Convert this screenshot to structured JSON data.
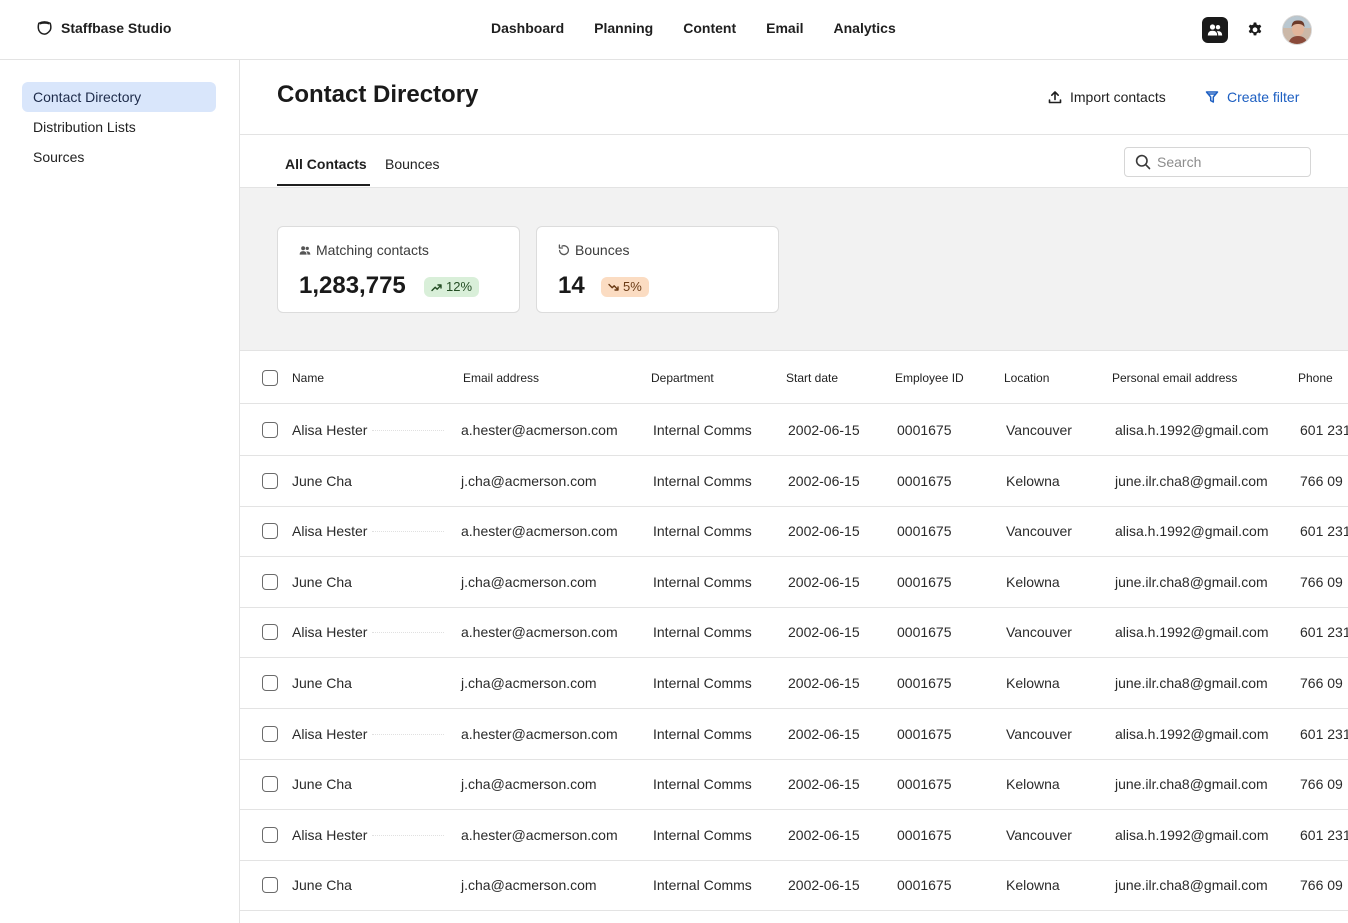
{
  "app": {
    "brand": "Staffbase Studio"
  },
  "nav": [
    "Dashboard",
    "Planning",
    "Content",
    "Email",
    "Analytics"
  ],
  "topbar": {
    "icons": [
      "people-icon",
      "gear-icon",
      "user-avatar"
    ]
  },
  "sidebar": {
    "items": [
      {
        "label": "Contact Directory",
        "active": true
      },
      {
        "label": "Distribution Lists",
        "active": false
      },
      {
        "label": "Sources",
        "active": false
      }
    ]
  },
  "page": {
    "title": "Contact Directory",
    "import_label": "Import contacts",
    "filter_label": "Create filter"
  },
  "tabs": [
    {
      "label": "All Contacts",
      "active": true
    },
    {
      "label": "Bounces",
      "active": false
    }
  ],
  "search": {
    "placeholder": "Search",
    "value": ""
  },
  "stats": {
    "matching": {
      "label": "Matching contacts",
      "value": "1,283,775",
      "change": "12%",
      "trend": "up"
    },
    "bounces": {
      "label": "Bounces",
      "value": "14",
      "change": "5%",
      "trend": "down"
    }
  },
  "table": {
    "columns": [
      "Name",
      "Email address",
      "Department",
      "Start date",
      "Employee ID",
      "Location",
      "Personal email address",
      "Phone"
    ],
    "rows": [
      {
        "name": "Alisa Hester",
        "email": "a.hester@acmerson.com",
        "department": "Internal Comms",
        "start": "2002-06-15",
        "id": "0001675",
        "location": "Vancouver",
        "personal": "alisa.h.1992@gmail.com",
        "phone": "601 231"
      },
      {
        "name": "June Cha",
        "email": "j.cha@acmerson.com",
        "department": "Internal Comms",
        "start": "2002-06-15",
        "id": "0001675",
        "location": "Kelowna",
        "personal": "june.ilr.cha8@gmail.com",
        "phone": "766 09"
      },
      {
        "name": "Alisa Hester",
        "email": "a.hester@acmerson.com",
        "department": "Internal Comms",
        "start": "2002-06-15",
        "id": "0001675",
        "location": "Vancouver",
        "personal": "alisa.h.1992@gmail.com",
        "phone": "601 231"
      },
      {
        "name": "June Cha",
        "email": "j.cha@acmerson.com",
        "department": "Internal Comms",
        "start": "2002-06-15",
        "id": "0001675",
        "location": "Kelowna",
        "personal": "june.ilr.cha8@gmail.com",
        "phone": "766 09"
      },
      {
        "name": "Alisa Hester",
        "email": "a.hester@acmerson.com",
        "department": "Internal Comms",
        "start": "2002-06-15",
        "id": "0001675",
        "location": "Vancouver",
        "personal": "alisa.h.1992@gmail.com",
        "phone": "601 231"
      },
      {
        "name": "June Cha",
        "email": "j.cha@acmerson.com",
        "department": "Internal Comms",
        "start": "2002-06-15",
        "id": "0001675",
        "location": "Kelowna",
        "personal": "june.ilr.cha8@gmail.com",
        "phone": "766 09"
      },
      {
        "name": "Alisa Hester",
        "email": "a.hester@acmerson.com",
        "department": "Internal Comms",
        "start": "2002-06-15",
        "id": "0001675",
        "location": "Vancouver",
        "personal": "alisa.h.1992@gmail.com",
        "phone": "601 231"
      },
      {
        "name": "June Cha",
        "email": "j.cha@acmerson.com",
        "department": "Internal Comms",
        "start": "2002-06-15",
        "id": "0001675",
        "location": "Kelowna",
        "personal": "june.ilr.cha8@gmail.com",
        "phone": "766 09"
      },
      {
        "name": "Alisa Hester",
        "email": "a.hester@acmerson.com",
        "department": "Internal Comms",
        "start": "2002-06-15",
        "id": "0001675",
        "location": "Vancouver",
        "personal": "alisa.h.1992@gmail.com",
        "phone": "601 231"
      },
      {
        "name": "June Cha",
        "email": "j.cha@acmerson.com",
        "department": "Internal Comms",
        "start": "2002-06-15",
        "id": "0001675",
        "location": "Kelowna",
        "personal": "june.ilr.cha8@gmail.com",
        "phone": "766 09"
      }
    ]
  },
  "colors": {
    "accent": "#1d5fc2",
    "active_nav_bg": "#d9e6fb",
    "up_badge": "#d9efd9",
    "down_badge": "#fbdcc2"
  }
}
